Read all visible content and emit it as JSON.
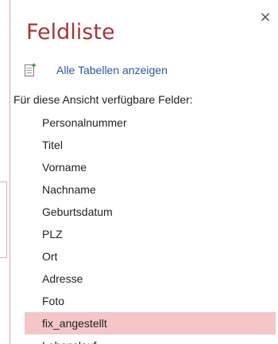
{
  "pane": {
    "title": "Feldliste",
    "close_glyph": "×",
    "show_all_label": "Alle Tabellen anzeigen",
    "show_all_icon": "table-add-icon",
    "section_label": "Für diese Ansicht verfügbare Felder:",
    "fields": [
      "Personalnummer",
      "Titel",
      "Vorname",
      "Nachname",
      "Geburtsdatum",
      "PLZ",
      "Ort",
      "Adresse",
      "Foto",
      "fix_angestellt",
      "Lebenslauf"
    ],
    "selected_field": "fix_angestellt"
  },
  "colors": {
    "title": "#a4373a",
    "link": "#2b579a",
    "selection": "#f4c6c8",
    "pane_border": "#d6a7a7"
  }
}
